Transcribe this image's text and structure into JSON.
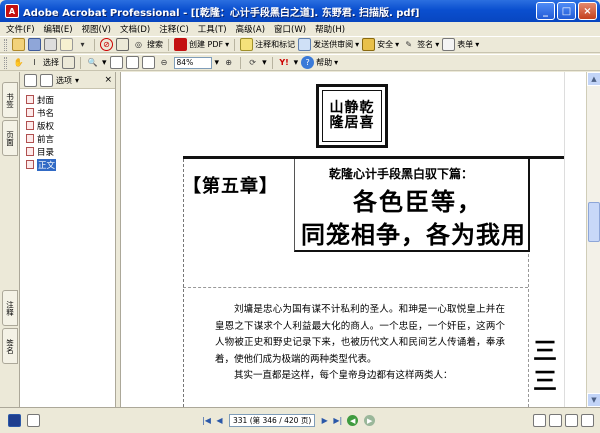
{
  "window": {
    "app_icon": "A",
    "title": "Adobe Acrobat Professional - [[乾隆：心计手段黑白之道]. 东野君. 扫描版. pdf]",
    "minimize": "_",
    "maximize": "□",
    "close": "×"
  },
  "menu": {
    "items": [
      "文件(F)",
      "编辑(E)",
      "视图(V)",
      "文档(D)",
      "注释(C)",
      "工具(T)",
      "高级(A)",
      "窗口(W)",
      "帮助(H)"
    ]
  },
  "toolbar1": {
    "search_label": "搜索",
    "create_pdf_label": "创建 PDF",
    "comment_label": "注释和标记",
    "review_label": "发送供审阅",
    "secure_label": "安全",
    "sign_label": "签名",
    "forms_label": "表单"
  },
  "toolbar2": {
    "select_label": "选择",
    "zoom_value": "84%",
    "help_label": "帮助"
  },
  "side_tabs": {
    "bookmarks": "书签",
    "pages": "页面",
    "comments": "注释",
    "signatures": "签名"
  },
  "bookmarks": {
    "options_label": "选项",
    "close": "×",
    "items": [
      {
        "label": "封面",
        "selected": false
      },
      {
        "label": "书名",
        "selected": false
      },
      {
        "label": "版权",
        "selected": false
      },
      {
        "label": "前言",
        "selected": false
      },
      {
        "label": "目录",
        "selected": false
      },
      {
        "label": "正文",
        "selected": true
      }
    ]
  },
  "document": {
    "seal_text": "山静乾隆居喜",
    "chapter_label": "【第五章】",
    "subtitle": "乾隆心计手段黑白驭下篇：",
    "headline_line1": "各色臣等，",
    "headline_line2": "同笼相争，各为我用",
    "body_paragraphs": [
      "刘墉是忠心为国有谋不计私利的圣人。和珅是一心取悦皇上并在皇恩之下谋求个人利益最大化的商人。一个忠臣，一个奸臣，这两个人物被正史和野史记录下来，也被历代文人和民间艺人传诵着，奉承着，使他们成为极端的两种类型代表。",
      "其实一直都是这样，每个皇帝身边都有这样两类人："
    ],
    "side_marker": "三三"
  },
  "statusbar": {
    "page_field": "331 (第 346 / 420 页)"
  }
}
